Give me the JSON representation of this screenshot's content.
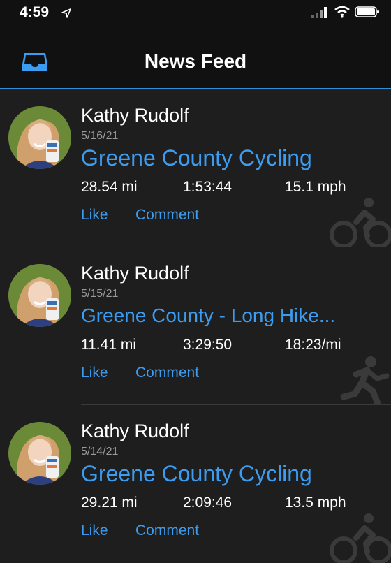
{
  "status_bar": {
    "time": "4:59"
  },
  "header": {
    "title": "News Feed"
  },
  "feed": [
    {
      "name": "Kathy Rudolf",
      "date": "5/16/21",
      "activity": "Greene County Cycling",
      "distance": "28.54 mi",
      "duration": "1:53:44",
      "pace": "15.1 mph",
      "like": "Like",
      "comment": "Comment",
      "icon": "cycling-icon"
    },
    {
      "name": "Kathy Rudolf",
      "date": "5/15/21",
      "activity": "Greene County - Long Hike...",
      "distance": "11.41 mi",
      "duration": "3:29:50",
      "pace": "18:23/mi",
      "like": "Like",
      "comment": "Comment",
      "icon": "running-icon"
    },
    {
      "name": "Kathy Rudolf",
      "date": "5/14/21",
      "activity": "Greene County Cycling",
      "distance": "29.21 mi",
      "duration": "2:09:46",
      "pace": "13.5 mph",
      "like": "Like",
      "comment": "Comment",
      "icon": "cycling-icon"
    }
  ],
  "colors": {
    "accent": "#3c9cf0",
    "background": "#1e1e1e",
    "topbar": "#111111"
  }
}
